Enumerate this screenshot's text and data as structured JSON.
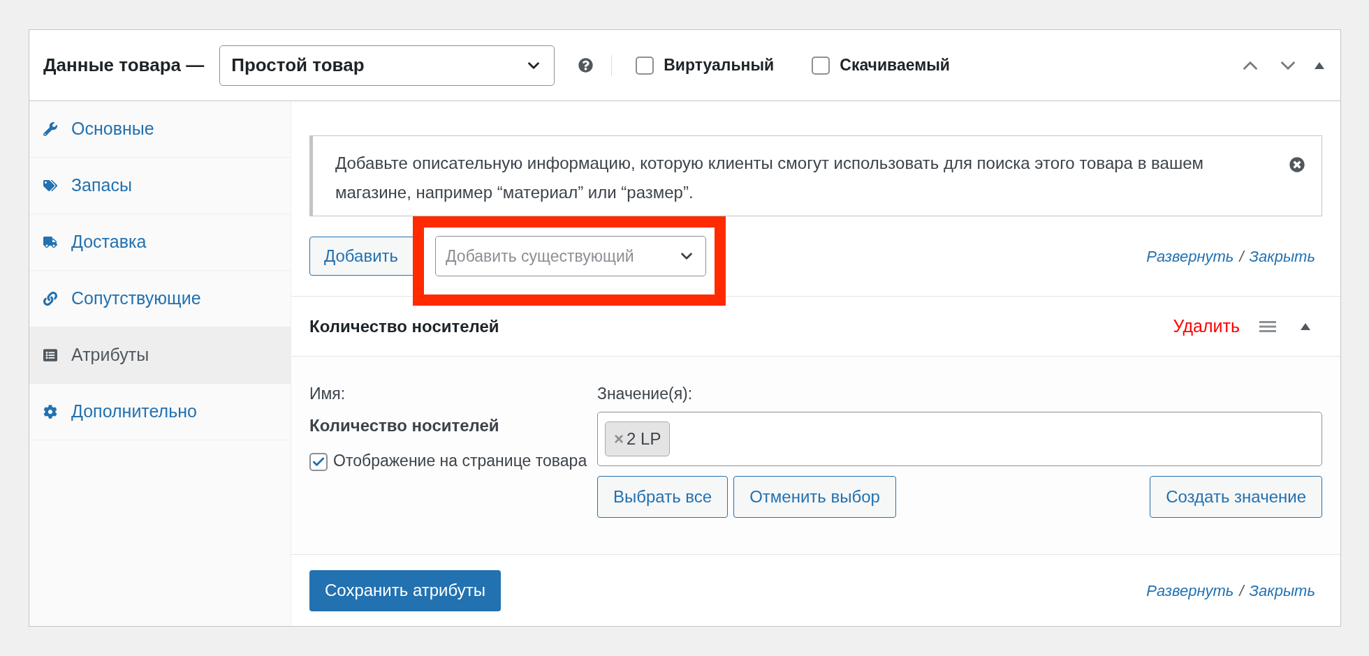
{
  "product_data": {
    "title": "Данные товара —",
    "product_type": "Простой товар",
    "options": [
      {
        "label": "Виртуальный",
        "checked": false
      },
      {
        "label": "Скачиваемый",
        "checked": false
      }
    ]
  },
  "tabs": [
    {
      "label": "Основные",
      "selected": false
    },
    {
      "label": "Запасы",
      "selected": false
    },
    {
      "label": "Доставка",
      "selected": false
    },
    {
      "label": "Сопутствующие",
      "selected": false
    },
    {
      "label": "Атрибуты",
      "selected": true
    },
    {
      "label": "Дополнительно",
      "selected": false
    }
  ],
  "notice": {
    "text": "Добавьте описательную информацию, которую клиенты смогут использовать для поиска этого товара в вашем магазине, например “материал” или “размер”."
  },
  "toolbar": {
    "add_button": "Добавить",
    "existing_select": {
      "placeholder": "Добавить существующий"
    },
    "expand": "Развернуть",
    "separator": "/",
    "collapse": "Закрыть"
  },
  "attributes": [
    {
      "title": "Количество носителей",
      "remove": "Удалить",
      "expanded": true,
      "name_label": "Имя:",
      "name": "Количество носителей",
      "visible": {
        "label": "Отображение на странице товара",
        "checked": true
      },
      "values_label": "Значение(я):",
      "values": [
        {
          "remove": "×",
          "label": "2 LP"
        }
      ],
      "buttons": [
        "Выбрать все",
        "Отменить выбор",
        "Создать значение"
      ]
    }
  ],
  "footer": {
    "save_button": "Сохранить атрибуты",
    "expand": "Развернуть",
    "separator": "/",
    "collapse": "Закрыть"
  }
}
